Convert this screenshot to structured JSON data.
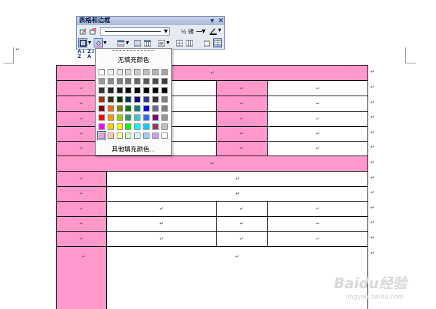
{
  "toolbar": {
    "title": "表格和边框",
    "line_weight": "½ 磅",
    "icons": [
      "draw-table-icon",
      "eraser-icon",
      "line-style-combo",
      "line-weight-combo",
      "border-color-icon",
      "outside-border-icon",
      "shading-color-icon",
      "insert-table-icon",
      "merge-cells-icon",
      "split-cells-icon",
      "align-icon",
      "distribute-rows-icon",
      "distribute-columns-icon",
      "autoformat-icon",
      "show-gridlines-icon",
      "sort-ascending-icon",
      "sort-descending-icon"
    ]
  },
  "dropdown": {
    "no_fill_label": "无填充颜色",
    "more_colors_label": "其他填充颜色...",
    "swatches": [
      [
        "#ffffff",
        "#f2f2f2",
        "#e6e6e6",
        "#d9d9d9",
        "#cccccc",
        "#c0c0c0",
        "#b3b3b3",
        "#a6a6a6"
      ],
      [
        "#999999",
        "#8c8c8c",
        "#808080",
        "#737373",
        "#666666",
        "#595959",
        "#4d4d4d",
        "#404040"
      ],
      [
        "#333333",
        "#262626",
        "#1a1a1a",
        "#0d0d0d",
        "#000000",
        "#000000",
        "#000000",
        "#000000"
      ],
      [
        "#993300",
        "#333300",
        "#003300",
        "#003366",
        "#000080",
        "#333399",
        "#333333",
        "#808080"
      ],
      [
        "#800000",
        "#ff6600",
        "#808000",
        "#008000",
        "#008080",
        "#0000ff",
        "#666699",
        "#808080"
      ],
      [
        "#ff0000",
        "#ff9900",
        "#99cc00",
        "#339966",
        "#33cccc",
        "#3366ff",
        "#800080",
        "#969696"
      ],
      [
        "#ff00ff",
        "#ffcc00",
        "#ffff00",
        "#00ff00",
        "#00ffff",
        "#00ccff",
        "#993366",
        "#c0c0c0"
      ],
      [
        "#ff99cc",
        "#ffcc99",
        "#ffff99",
        "#ccffcc",
        "#ccffff",
        "#99ccff",
        "#cc99ff",
        "#ffffff"
      ]
    ],
    "selected": "#ff99cc"
  },
  "document": {
    "cell_mark": "↵",
    "shading_color": "#ff99cc"
  },
  "watermark": {
    "brand": "Baidu经验",
    "sub": "jingyan.baidu.com"
  }
}
